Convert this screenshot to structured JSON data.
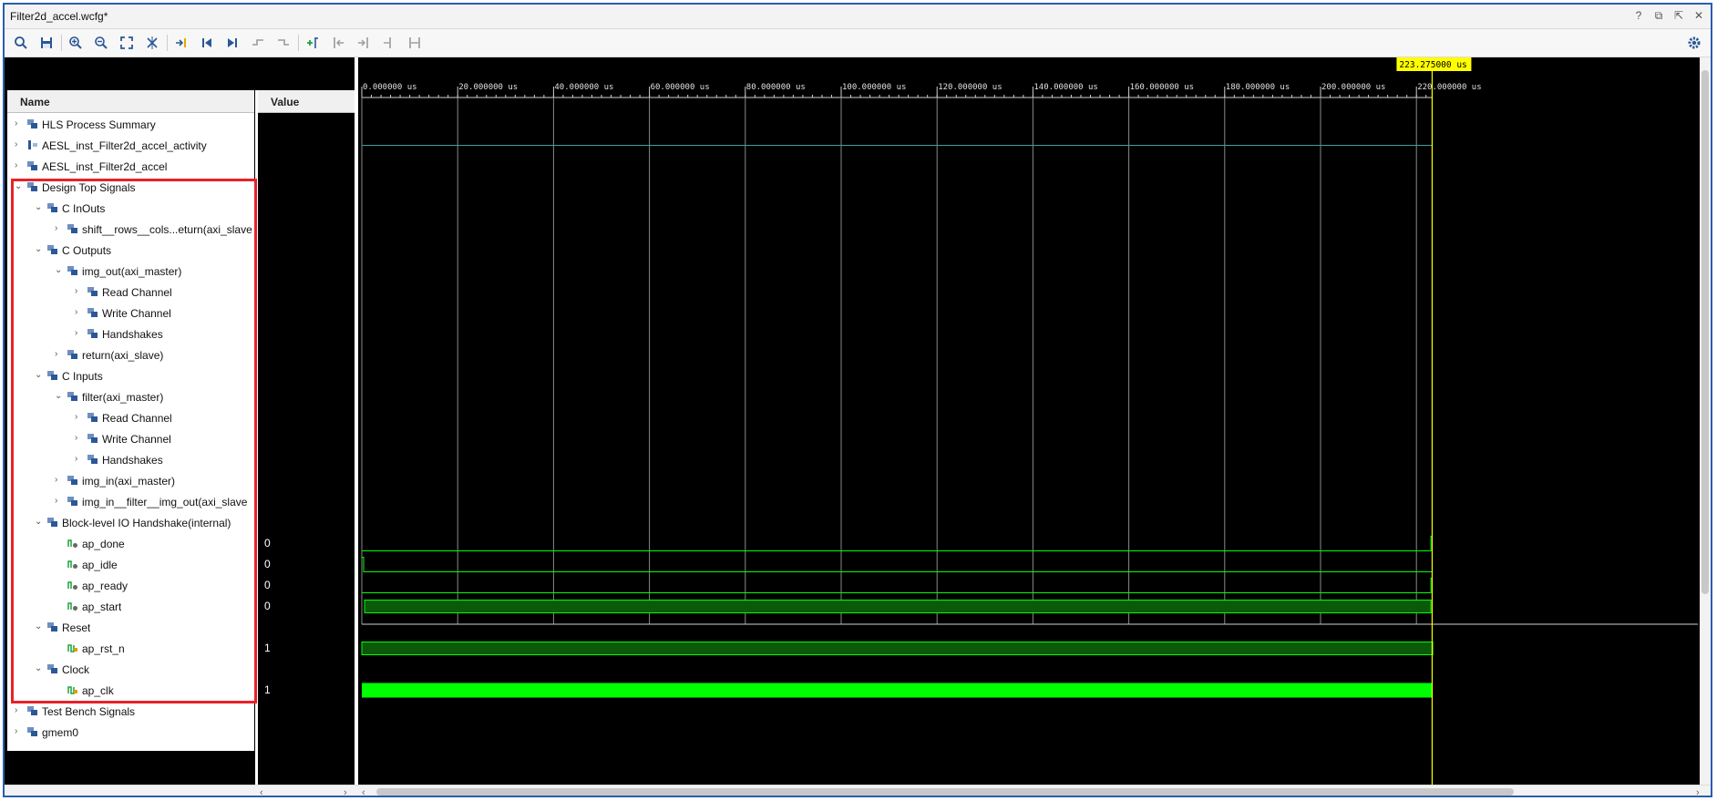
{
  "window": {
    "title": "Filter2d_accel.wcfg*",
    "controls": [
      "?",
      "⧉",
      "⇱",
      "✕"
    ]
  },
  "toolbar": {
    "buttons": [
      "search-icon",
      "save-icon",
      "zoom-in-icon",
      "zoom-out-icon",
      "zoom-fit-icon",
      "swap-icon",
      "go-to-cursor-icon",
      "go-to-start-icon",
      "go-to-end-icon",
      "previous-transition-icon",
      "next-transition-icon",
      "add-marker-icon",
      "previous-marker-icon",
      "next-marker-icon",
      "swap-cursors-icon",
      "snap-icon"
    ],
    "settings_icon": "gear-icon"
  },
  "columns": {
    "name": "Name",
    "value": "Value"
  },
  "signals": [
    {
      "label": "HLS Process Summary",
      "level": 0,
      "expanded": false,
      "icon": "group-icon",
      "value": ""
    },
    {
      "label": "AESL_inst_Filter2d_accel_activity",
      "level": 0,
      "expanded": false,
      "icon": "activity-icon",
      "value": ""
    },
    {
      "label": "AESL_inst_Filter2d_accel",
      "level": 0,
      "expanded": false,
      "icon": "group-icon",
      "value": ""
    },
    {
      "label": "Design Top Signals",
      "level": 0,
      "expanded": true,
      "icon": "group-icon",
      "value": ""
    },
    {
      "label": "C InOuts",
      "level": 1,
      "expanded": true,
      "icon": "group-icon",
      "value": ""
    },
    {
      "label": "shift__rows__cols...eturn(axi_slave",
      "level": 2,
      "expanded": false,
      "icon": "group-icon",
      "value": ""
    },
    {
      "label": "C Outputs",
      "level": 1,
      "expanded": true,
      "icon": "group-icon",
      "value": ""
    },
    {
      "label": "img_out(axi_master)",
      "level": 2,
      "expanded": true,
      "icon": "group-icon",
      "value": ""
    },
    {
      "label": "Read Channel",
      "level": 3,
      "expanded": false,
      "icon": "group-icon",
      "value": ""
    },
    {
      "label": "Write Channel",
      "level": 3,
      "expanded": false,
      "icon": "group-icon",
      "value": ""
    },
    {
      "label": "Handshakes",
      "level": 3,
      "expanded": false,
      "icon": "group-icon",
      "value": ""
    },
    {
      "label": "return(axi_slave)",
      "level": 2,
      "expanded": false,
      "icon": "group-icon",
      "value": ""
    },
    {
      "label": "C Inputs",
      "level": 1,
      "expanded": true,
      "icon": "group-icon",
      "value": ""
    },
    {
      "label": "filter(axi_master)",
      "level": 2,
      "expanded": true,
      "icon": "group-icon",
      "value": ""
    },
    {
      "label": "Read Channel",
      "level": 3,
      "expanded": false,
      "icon": "group-icon",
      "value": ""
    },
    {
      "label": "Write Channel",
      "level": 3,
      "expanded": false,
      "icon": "group-icon",
      "value": ""
    },
    {
      "label": "Handshakes",
      "level": 3,
      "expanded": false,
      "icon": "group-icon",
      "value": ""
    },
    {
      "label": "img_in(axi_master)",
      "level": 2,
      "expanded": false,
      "icon": "group-icon",
      "value": ""
    },
    {
      "label": "img_in__filter__img_out(axi_slave",
      "level": 2,
      "expanded": false,
      "icon": "group-icon",
      "value": ""
    },
    {
      "label": "Block-level IO Handshake(internal)",
      "level": 1,
      "expanded": true,
      "icon": "group-icon",
      "value": ""
    },
    {
      "label": "ap_done",
      "level": 2,
      "leaf": true,
      "icon": "signal-out-icon",
      "value": "0"
    },
    {
      "label": "ap_idle",
      "level": 2,
      "leaf": true,
      "icon": "signal-out-icon",
      "value": "0"
    },
    {
      "label": "ap_ready",
      "level": 2,
      "leaf": true,
      "icon": "signal-out-icon",
      "value": "0"
    },
    {
      "label": "ap_start",
      "level": 2,
      "leaf": true,
      "icon": "signal-out-icon",
      "value": "0"
    },
    {
      "label": "Reset",
      "level": 1,
      "expanded": true,
      "icon": "group-icon",
      "value": ""
    },
    {
      "label": "ap_rst_n",
      "level": 2,
      "leaf": true,
      "icon": "signal-in-icon",
      "value": "1"
    },
    {
      "label": "Clock",
      "level": 1,
      "expanded": true,
      "icon": "group-icon",
      "value": ""
    },
    {
      "label": "ap_clk",
      "level": 2,
      "leaf": true,
      "icon": "signal-in-icon",
      "value": "1"
    },
    {
      "label": "Test Bench Signals",
      "level": 0,
      "expanded": false,
      "icon": "group-icon",
      "value": ""
    },
    {
      "label": "gmem0",
      "level": 0,
      "expanded": false,
      "icon": "group-icon",
      "value": ""
    }
  ],
  "timeline": {
    "ticks": [
      "0.000000 us",
      "20.000000 us",
      "40.000000 us",
      "60.000000 us",
      "80.000000 us",
      "100.000000 us",
      "120.000000 us",
      "140.000000 us",
      "160.000000 us",
      "180.000000 us",
      "200.000000 us",
      "220.000000 us"
    ],
    "cursor_label": "223.275000 us",
    "cursor_us": 223.275,
    "end_us": 223.4,
    "colors": {
      "waveform": "#00ff00",
      "grid": "#8a8a8a",
      "cursor": "#ffff00",
      "bus": "#3aa0a0",
      "highlight": "#e8222a"
    }
  }
}
